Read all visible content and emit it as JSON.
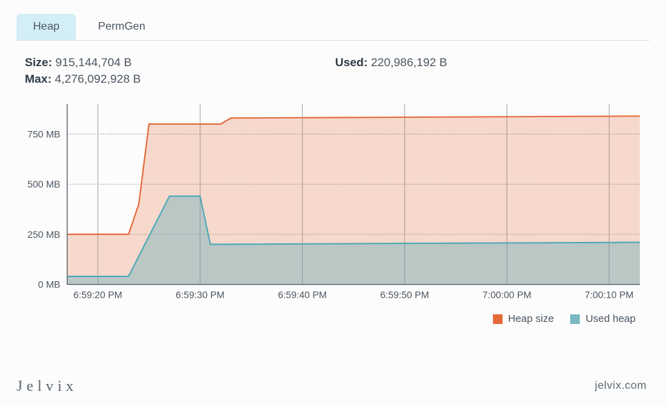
{
  "tabs": {
    "heap": "Heap",
    "permgen": "PermGen",
    "active": "heap"
  },
  "stats": {
    "size": {
      "label": "Size:",
      "value": "915,144,704 B"
    },
    "used": {
      "label": "Used:",
      "value": "220,986,192 B"
    },
    "max": {
      "label": "Max:",
      "value": "4,276,092,928 B"
    }
  },
  "legend": {
    "size": "Heap size",
    "used": "Used heap"
  },
  "colors": {
    "heap_size": "#e46a3a",
    "used_heap": "#4ca9b7"
  },
  "footer": {
    "brand": "Jelvix",
    "site": "jelvix.com"
  },
  "chart_data": {
    "type": "area",
    "xlabel": "",
    "ylabel": "",
    "x_ticks": [
      "6:59:20 PM",
      "6:59:30 PM",
      "6:59:40 PM",
      "6:59:50 PM",
      "7:00:00 PM",
      "7:00:10 PM"
    ],
    "y_ticks": [
      "0 MB",
      "250 MB",
      "500 MB",
      "750 MB"
    ],
    "ylim": [
      0,
      900
    ],
    "xlim_seconds": [
      17,
      73
    ],
    "series": [
      {
        "name": "Heap size",
        "color": "#e46a3a",
        "points": [
          {
            "t": 17,
            "mb": 250
          },
          {
            "t": 23,
            "mb": 250
          },
          {
            "t": 24,
            "mb": 400
          },
          {
            "t": 25,
            "mb": 800
          },
          {
            "t": 32,
            "mb": 800
          },
          {
            "t": 33,
            "mb": 830
          },
          {
            "t": 73,
            "mb": 840
          }
        ]
      },
      {
        "name": "Used heap",
        "color": "#4ca9b7",
        "points": [
          {
            "t": 17,
            "mb": 40
          },
          {
            "t": 23,
            "mb": 40
          },
          {
            "t": 27,
            "mb": 440
          },
          {
            "t": 30,
            "mb": 440
          },
          {
            "t": 31,
            "mb": 200
          },
          {
            "t": 73,
            "mb": 210
          }
        ]
      }
    ]
  }
}
